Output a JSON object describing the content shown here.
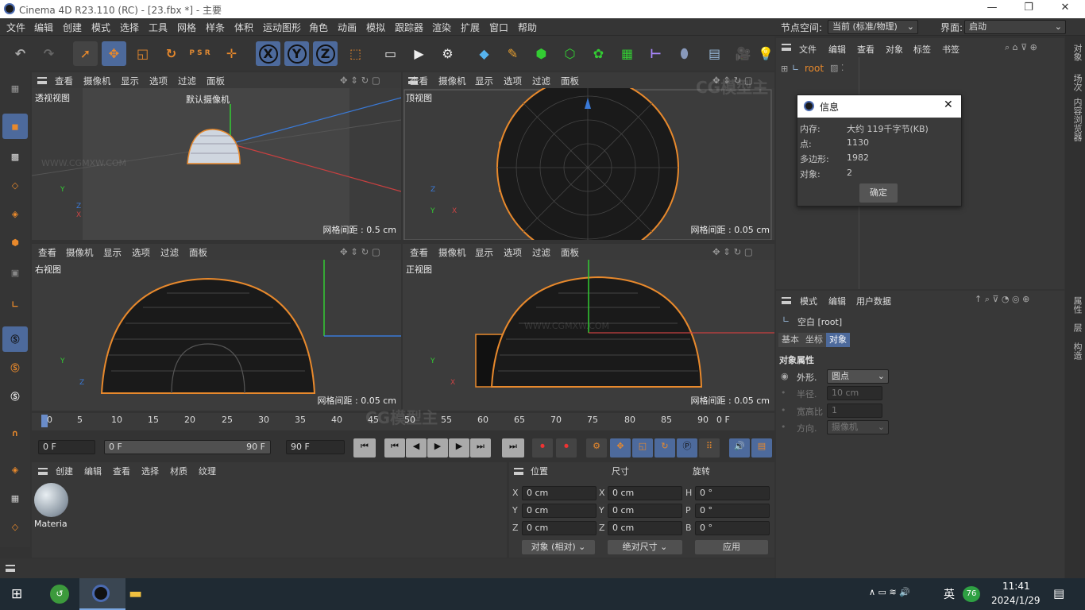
{
  "window": {
    "title": "Cinema 4D R23.110 (RC) - [23.fbx *] - 主要"
  },
  "menu": [
    "文件",
    "编辑",
    "创建",
    "模式",
    "选择",
    "工具",
    "网格",
    "样条",
    "体积",
    "运动图形",
    "角色",
    "动画",
    "模拟",
    "跟踪器",
    "渲染",
    "扩展",
    "窗口",
    "帮助"
  ],
  "node_space": {
    "label": "节点空间:",
    "value": "当前 (标准/物理)"
  },
  "layout": {
    "label": "界面:",
    "value": "启动"
  },
  "toolbar_letters": {
    "x": "X",
    "y": "Y",
    "z": "Z",
    "psr": "P S R"
  },
  "viewport_menu": [
    "查看",
    "摄像机",
    "显示",
    "选项",
    "过滤",
    "面板"
  ],
  "viewports": [
    {
      "name": "透视视图",
      "camera": "默认摄像机",
      "grid": "网格间距 : 0.5 cm"
    },
    {
      "name": "顶视图",
      "grid": "网格间距 : 0.05 cm"
    },
    {
      "name": "右视图",
      "grid": "网格间距 : 0.05 cm"
    },
    {
      "name": "正视图",
      "grid": "网格间距 : 0.05 cm"
    }
  ],
  "axes": {
    "x": "X",
    "y": "Y",
    "z": "Z"
  },
  "timeline": {
    "ticks": [
      "0",
      "5",
      "10",
      "15",
      "20",
      "25",
      "30",
      "35",
      "40",
      "45",
      "50",
      "55",
      "60",
      "65",
      "70",
      "75",
      "80",
      "85",
      "90"
    ],
    "end_frame": "0 F"
  },
  "playback": {
    "current": "0 F",
    "range_start": "0 F",
    "range_end": "90 F",
    "max": "90 F"
  },
  "material_menu": [
    "创建",
    "编辑",
    "查看",
    "选择",
    "材质",
    "纹理"
  ],
  "material": {
    "name": "Materia"
  },
  "coords": {
    "headers": [
      "位置",
      "尺寸",
      "旋转"
    ],
    "rows": [
      {
        "a": "X",
        "av": "0 cm",
        "b": "X",
        "bv": "0 cm",
        "c": "H",
        "cv": "0 °"
      },
      {
        "a": "Y",
        "av": "0 cm",
        "b": "Y",
        "bv": "0 cm",
        "c": "P",
        "cv": "0 °"
      },
      {
        "a": "Z",
        "av": "0 cm",
        "b": "Z",
        "bv": "0 cm",
        "c": "B",
        "cv": "0 °"
      }
    ],
    "mode": "对象 (相对)",
    "size_mode": "绝对尺寸",
    "apply": "应用"
  },
  "object_manager": {
    "menu": [
      "文件",
      "编辑",
      "查看",
      "对象",
      "标签",
      "书签"
    ],
    "root": "root"
  },
  "info_dialog": {
    "title": "信息",
    "rows": [
      {
        "k": "内存:",
        "v": "大约 119千字节(KB)"
      },
      {
        "k": "点:",
        "v": "1130"
      },
      {
        "k": "多边形:",
        "v": "1982"
      },
      {
        "k": "对象:",
        "v": "2"
      }
    ],
    "ok": "确定"
  },
  "attr": {
    "menu": [
      "模式",
      "编辑",
      "用户数据"
    ],
    "object": "空白 [root]",
    "tabs": [
      "基本",
      "坐标",
      "对象"
    ],
    "section": "对象属性",
    "props": [
      {
        "k": "外形.",
        "v": "圆点"
      },
      {
        "k": "半径.",
        "v": "10 cm"
      },
      {
        "k": "宽高比",
        "v": "1"
      },
      {
        "k": "方向.",
        "v": "摄像机"
      }
    ]
  },
  "side_tabs_top": [
    "对象",
    "场次",
    "内容浏览器"
  ],
  "side_tabs_bottom": [
    "属性",
    "层",
    "构造"
  ],
  "watermark": {
    "site": "WWW.CGMXW.COM",
    "brand": "CG模型主"
  },
  "taskbar": {
    "time": "11:41",
    "date": "2024/1/29",
    "ime": "英",
    "badge": "76"
  },
  "colors": {
    "accent": "#4d6a9c",
    "orange": "#e8892c",
    "selection": "#4d6a9c"
  }
}
